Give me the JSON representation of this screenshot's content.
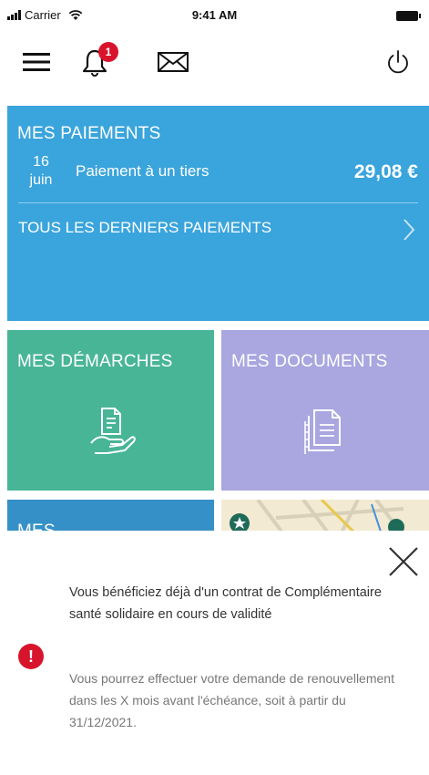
{
  "status_bar": {
    "carrier": "Carrier",
    "time": "9:41 AM"
  },
  "header": {
    "notification_count": "1",
    "icons": [
      "menu-icon",
      "bell-icon",
      "mail-icon",
      "power-icon"
    ]
  },
  "payments_tile": {
    "title": "MES PAIEMENTS",
    "latest": {
      "day": "16",
      "month": "juin",
      "label": "Paiement à un tiers",
      "amount": "29,08 €"
    },
    "all_link": "TOUS LES DERNIERS PAIEMENTS",
    "color": "#3aa4dc"
  },
  "tiles": [
    {
      "title": "MES DÉMARCHES",
      "icon": "hand-document-icon",
      "color": "#48b596"
    },
    {
      "title": "MES DOCUMENTS",
      "icon": "documents-icon",
      "color": "#a9a6e0"
    },
    {
      "title": "MES",
      "color": "#3590c8"
    },
    {
      "title": "",
      "icon": "map-icon",
      "color": "#f2ead2"
    }
  ],
  "alert_sheet": {
    "message": "Vous bénéficiez déjà d'un contrat de Complémentaire santé solidaire en cours de validité",
    "detail": "Vous pourrez effectuer votre demande de renouvellement dans les X mois avant l'échéance, soit à partir du 31/12/2021.",
    "alert_color": "#d8142c"
  }
}
